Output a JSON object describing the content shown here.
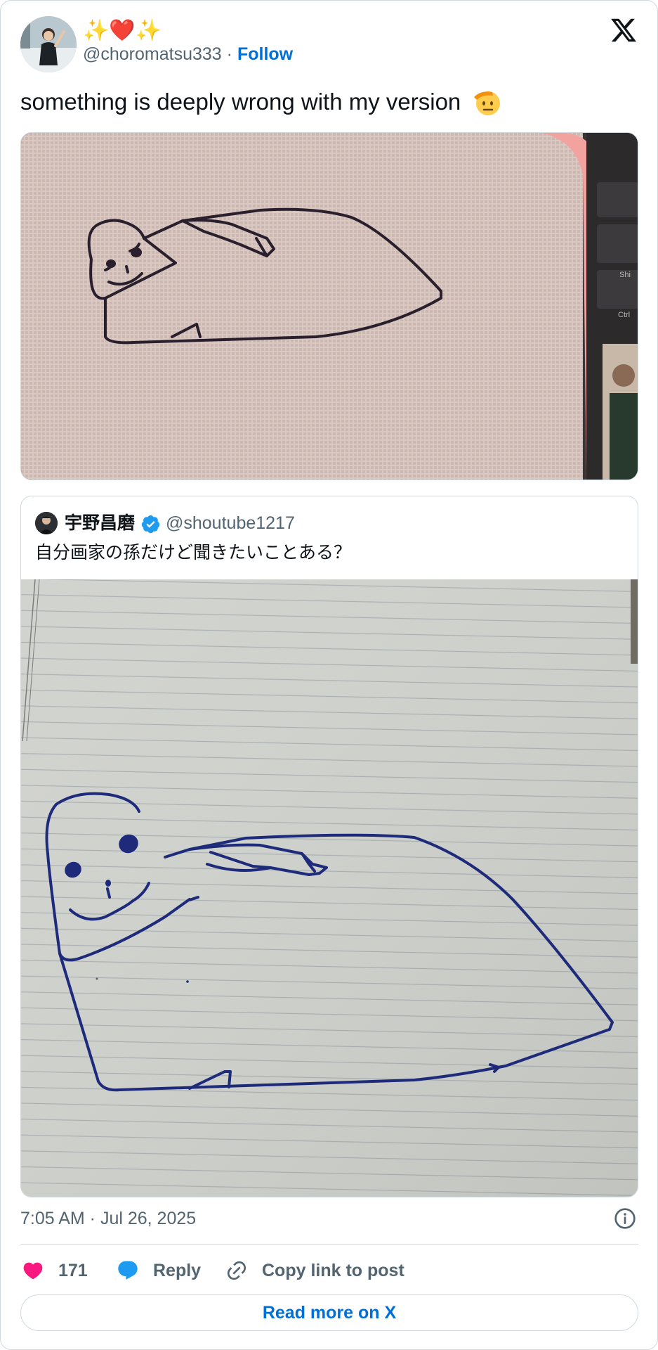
{
  "author": {
    "display_name": "✨❤️✨",
    "handle": "@choromatsu333",
    "separator": "·",
    "follow_label": "Follow",
    "avatar_icon": "user-avatar-photo"
  },
  "tweet": {
    "text": "something is deeply wrong with my version",
    "emoji_icon": "saluting-face-emoji",
    "photo_icon": "embroidered-seal-drawing-photo"
  },
  "quote": {
    "display_name": "宇野昌磨",
    "verified_icon": "verified-badge-icon",
    "handle": "@shoutube1217",
    "text": "自分画家の孫だけど聞きたいことある？",
    "photo_icon": "pen-seal-drawing-on-lined-paper-photo"
  },
  "meta": {
    "timestamp": "7:05 AM · Jul 26, 2025"
  },
  "actions": {
    "like_count": "171",
    "reply_label": "Reply",
    "copy_label": "Copy link to post",
    "read_more_label": "Read more on X"
  },
  "colors": {
    "accent": "#006fd6",
    "like": "#f91880",
    "reply": "#1d9bf0",
    "secondary_text": "#536471",
    "border": "#cfd9de"
  }
}
